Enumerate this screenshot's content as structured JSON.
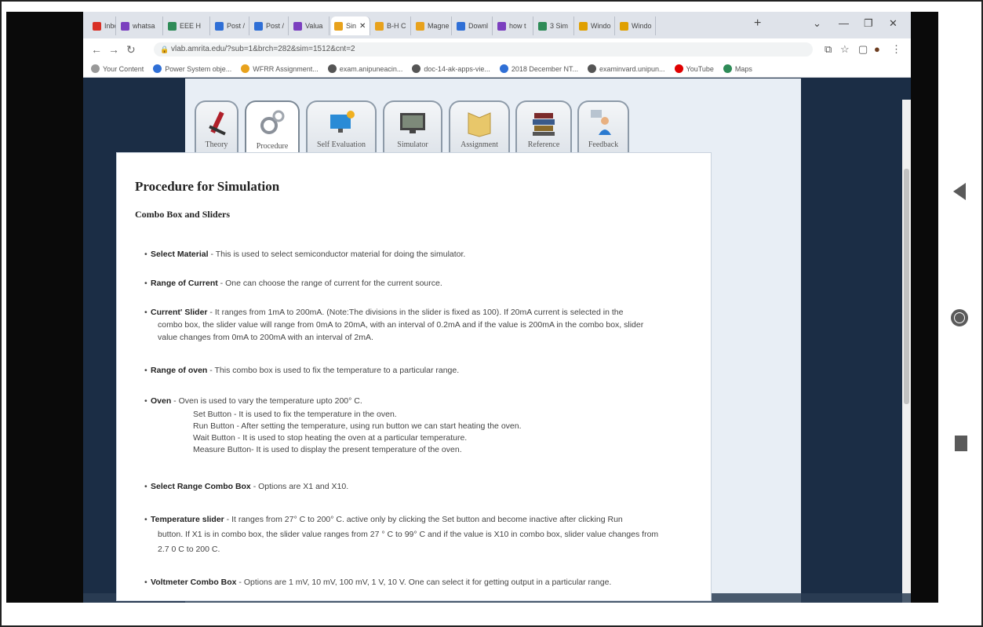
{
  "browser": {
    "tabs": [
      {
        "label": "Inbox",
        "color": "#d93025"
      },
      {
        "label": "whatsa",
        "color": "#7b3fbf"
      },
      {
        "label": "EEE H",
        "color": "#2e8b57"
      },
      {
        "label": "Post /",
        "color": "#2f6fd6"
      },
      {
        "label": "Post /",
        "color": "#2f6fd6"
      },
      {
        "label": "Valua",
        "color": "#7b3fbf"
      },
      {
        "label": "Sin",
        "color": "#e8a21c",
        "active": true
      },
      {
        "label": "B-H C",
        "color": "#e8a21c"
      },
      {
        "label": "Magne",
        "color": "#e8a21c"
      },
      {
        "label": "Downl",
        "color": "#2f6fd6"
      },
      {
        "label": "how t",
        "color": "#7b3fbf"
      },
      {
        "label": "3 Sim",
        "color": "#2e8b57"
      },
      {
        "label": "Windo",
        "color": "#e0a000"
      },
      {
        "label": "Windo",
        "color": "#e0a000"
      }
    ],
    "url": "vlab.amrita.edu/?sub=1&brch=282&sim=1512&cnt=2",
    "bookmarks": [
      {
        "label": "Your Content",
        "color": "#999999"
      },
      {
        "label": "Power System obje...",
        "color": "#2f6fd6"
      },
      {
        "label": "WFRR Assignment...",
        "color": "#e8a21c"
      },
      {
        "label": "exam.anipuneacin...",
        "color": "#555555"
      },
      {
        "label": "doc-14-ak-apps-vie...",
        "color": "#555555"
      },
      {
        "label": "2018 December NT...",
        "color": "#2f6fd6"
      },
      {
        "label": "examinvard.unipun...",
        "color": "#555555"
      },
      {
        "label": "YouTube",
        "color": "#e00000"
      },
      {
        "label": "Maps",
        "color": "#2e8b57"
      }
    ]
  },
  "lab_tabs": [
    {
      "label": "Theory",
      "icon": "pencil-icon"
    },
    {
      "label": "Procedure",
      "icon": "gears-icon",
      "active": true
    },
    {
      "label": "Self Evaluation",
      "icon": "monitor-evaluation-icon"
    },
    {
      "label": "Simulator",
      "icon": "screen-icon"
    },
    {
      "label": "Assignment",
      "icon": "book-icon"
    },
    {
      "label": "Reference",
      "icon": "books-stack-icon"
    },
    {
      "label": "Feedback",
      "icon": "person-feedback-icon"
    }
  ],
  "content": {
    "title": "Procedure for Simulation",
    "subtitle": "Combo Box and Sliders",
    "items": {
      "select_material": {
        "bold": "Select Material",
        "text": " - This is used to select semiconductor material for doing the simulator."
      },
      "range_current": {
        "bold": "Range of Current",
        "text": " - One can choose the range of current for the current source."
      },
      "current_slider": {
        "bold": "Current' Slider",
        "line1": " - It ranges from 1mA to 200mA. (Note:The divisions in the slider is fixed as 100). If 20mA current is selected in the",
        "line2": "combo     box, the slider value will range from 0mA to 20mA, with an interval of 0.2mA and if the value is 200mA in the combo box, slider",
        "line3": "value changes from 0mA to 200mA with an interval of 2mA."
      },
      "range_oven": {
        "bold": "Range of oven",
        "text": " - This combo box is used to fix the temperature to a particular range."
      },
      "oven": {
        "bold": "Oven",
        "text": " - Oven is used to vary the temperature upto 200° C.",
        "sub": [
          "Set Button - It is used to fix the temperature in the oven.",
          "Run Button - After setting the temperature, using run button we can start heating the oven.",
          "Wait Button - It is used to stop heating the oven at a particular temperature.",
          "Measure Button- It is used to display the present temperature of the oven."
        ]
      },
      "select_range": {
        "bold": "Select Range Combo Box",
        "text": " - Options are X1 and X10."
      },
      "temp_slider": {
        "bold": "Temperature slider",
        "line1": " - It ranges from 27° C to 200° C. active only by clicking the Set button and become inactive after clicking Run",
        "line2": "button. If X1 is in combo box, the slider value ranges from 27 ° C to 99° C and if the value is X10 in combo box, slider value changes from",
        "line3": "2.7 0 C to 200 C."
      },
      "voltmeter": {
        "bold": "Voltmeter Combo Box",
        "text": " - Options are 1 mV, 10 mV, 100 mV, 1 V, 10 V. One can select it for getting output in a particular range."
      }
    }
  }
}
